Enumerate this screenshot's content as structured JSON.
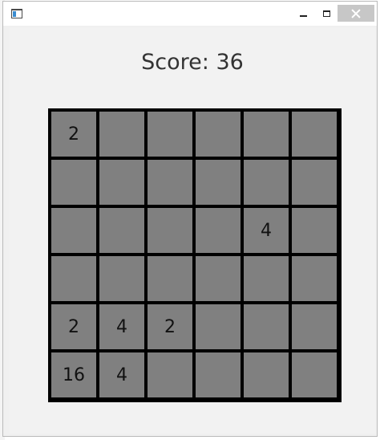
{
  "window": {
    "title_icon": "app-window-icon",
    "controls": [
      "minimize-icon",
      "maximize-icon",
      "close-icon"
    ]
  },
  "score": {
    "label": "Score: 36"
  },
  "board": {
    "size": 6,
    "rows": [
      [
        "2",
        "",
        "",
        "",
        "",
        ""
      ],
      [
        "",
        "",
        "",
        "",
        "",
        ""
      ],
      [
        "",
        "",
        "",
        "",
        "4",
        ""
      ],
      [
        "",
        "",
        "",
        "",
        "",
        ""
      ],
      [
        "2",
        "4",
        "2",
        "",
        "",
        ""
      ],
      [
        "16",
        "4",
        "",
        "",
        "",
        ""
      ]
    ]
  },
  "colors": {
    "cell": "#808080",
    "grid_lines": "#000000",
    "close_button": "#c7c7c7"
  }
}
